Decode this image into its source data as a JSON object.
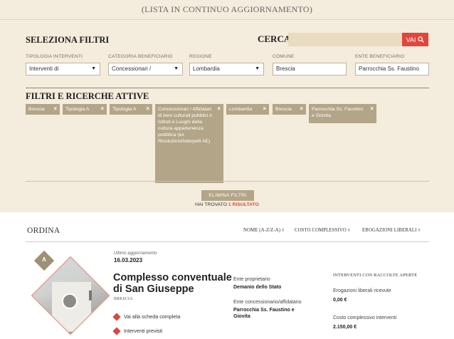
{
  "header": {
    "text": "(LISTA IN CONTINUO AGGIORNAMENTO)"
  },
  "filters": {
    "title": "SELEZIONA FILTRI",
    "cerca_label": "CERCA",
    "search_button": "VAI",
    "fields": [
      {
        "label": "TIPOLOGIA INTERVENTI",
        "value": "Interventi di"
      },
      {
        "label": "CATEGORIA BENEFICIARIO",
        "value": "Concessionari /"
      },
      {
        "label": "REGIONE",
        "value": "Lombardia"
      },
      {
        "label": "COMUNE",
        "value": "Brescia"
      },
      {
        "label": "ENTE BENEFICIARIO",
        "value": "Parrocchia Ss. Faustino"
      }
    ]
  },
  "active": {
    "title": "FILTRI E RICERCHE ATTIVE",
    "chips": [
      "Brescia",
      "Tipologia A",
      "Tipologia A",
      "Concessionari / Affidatari di beni culturali pubblici o Istituti e Luoghi della cultura appartenenza pubblica (ex Risoluzioni/Interpelli AE)",
      "Lombardia",
      "Brescia",
      "Parrocchia Ss. Faustino e Giovita"
    ],
    "remove_symbol": "×",
    "clear_button": "ELIMINA FILTRI",
    "found_prefix": "HAI TROVATO",
    "found_result": "1 RISULTATO"
  },
  "ordina": {
    "label": "ORDINA",
    "sort_options": [
      "NOME (A-Z/Z-A)",
      "COSTO COMPLESSIVO",
      "EROGAZIONI LIBERALI"
    ],
    "sort_arrow": "⬍"
  },
  "result": {
    "badge": "A",
    "updated_label": "Ultimo aggiornamento",
    "updated_date": "16.03.2023",
    "title_line1": "Complesso conventuale",
    "title_line2": "di San Giuseppe",
    "city": "BRESCIA",
    "link_scheda": "Vai alla scheda completa",
    "link_interventi": "Interventi previsti",
    "proprietario_label": "Ente proprietario",
    "proprietario_value": "Demanio dello Stato",
    "concessionario_label": "Ente concessionario/affidatario",
    "concessionario_value": "Parrocchia Ss. Faustino e Giovita",
    "raccolte_head": "INTERVENTI CON RACCOLTE APERTE",
    "erogazioni_label": "Erogazioni liberali ricevute",
    "erogazioni_value": "0,00 €",
    "costo_label": "Costo complessivo interventi",
    "costo_value": "2.150,00 €"
  },
  "colors": {
    "accent": "#e0463c",
    "panel": "#f4ecdc",
    "chip": "#b3a688"
  }
}
